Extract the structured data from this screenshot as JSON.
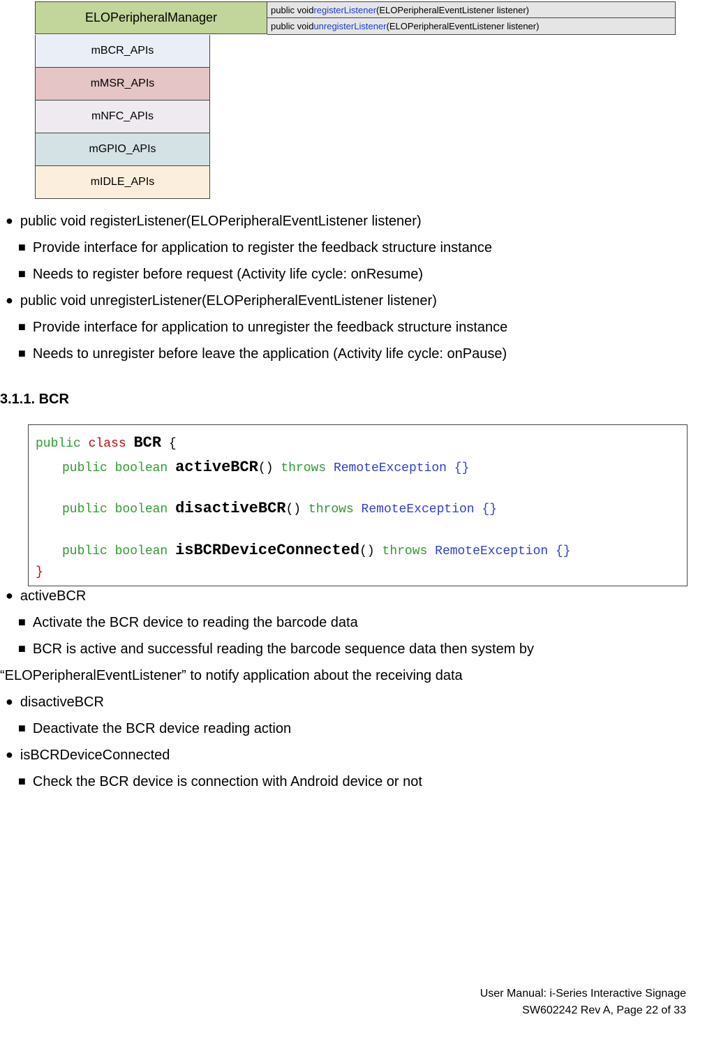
{
  "diagram": {
    "manager": "ELOPeripheralManager",
    "signatures": [
      {
        "prefix": "public void ",
        "method": "registerListener",
        "suffix": "(ELOPeripheralEventListener listener)"
      },
      {
        "prefix": "public void ",
        "method": "unregisterListener",
        "suffix": "(ELOPeripheralEventListener listener)"
      }
    ],
    "apis": [
      {
        "label": "mBCR_APIs",
        "class": "bcr-bg"
      },
      {
        "label": "mMSR_APIs",
        "class": "msr-bg"
      },
      {
        "label": "mNFC_APIs",
        "class": "nfc-bg"
      },
      {
        "label": "mGPIO_APIs",
        "class": "gpio-bg"
      },
      {
        "label": "mIDLE_APIs",
        "class": "idle-bg"
      }
    ]
  },
  "bullets_top": [
    {
      "marker": "●",
      "indent": false,
      "text": "public void registerListener(ELOPeripheralEventListener listener)"
    },
    {
      "marker": "■",
      "indent": true,
      "text": "Provide interface for application to register the feedback structure instance"
    },
    {
      "marker": "■",
      "indent": true,
      "text": "Needs to register before request (Activity life cycle: onResume)"
    },
    {
      "marker": "●",
      "indent": false,
      "text": "public void unregisterListener(ELOPeripheralEventListener listener)"
    },
    {
      "marker": "■",
      "indent": true,
      "text": "Provide interface for application to unregister the feedback structure instance"
    },
    {
      "marker": "■",
      "indent": true,
      "text": "Needs to unregister before leave the application (Activity life cycle: onPause)"
    }
  ],
  "section_heading": "3.1.1. BCR",
  "code": {
    "class_declaration": "BCR",
    "methods": [
      {
        "name": "activeBCR"
      },
      {
        "name": "disactiveBCR"
      },
      {
        "name": "isBCRDeviceConnected"
      }
    ]
  },
  "bullets_bottom": [
    {
      "marker": "●",
      "indent": false,
      "text": "activeBCR"
    },
    {
      "marker": "■",
      "indent": true,
      "text": "Activate the BCR device to reading the barcode data"
    },
    {
      "marker": "■",
      "indent": true,
      "text": "BCR is active and successful reading the barcode sequence data then system by"
    }
  ],
  "bullets_bottom_continuation": "“ELOPeripheralEventListener” to notify application about the receiving data",
  "bullets_bottom2": [
    {
      "marker": "●",
      "indent": false,
      "text": "disactiveBCR"
    },
    {
      "marker": "■",
      "indent": true,
      "text": "Deactivate the BCR device reading action"
    },
    {
      "marker": "●",
      "indent": false,
      "text": "isBCRDeviceConnected"
    },
    {
      "marker": "■",
      "indent": true,
      "text": "Check the BCR device is connection with Android device or not"
    }
  ],
  "footer": {
    "line1": "User Manual: i-Series Interactive Signage",
    "line2": "SW602242 Rev A, Page 22 of 33"
  }
}
